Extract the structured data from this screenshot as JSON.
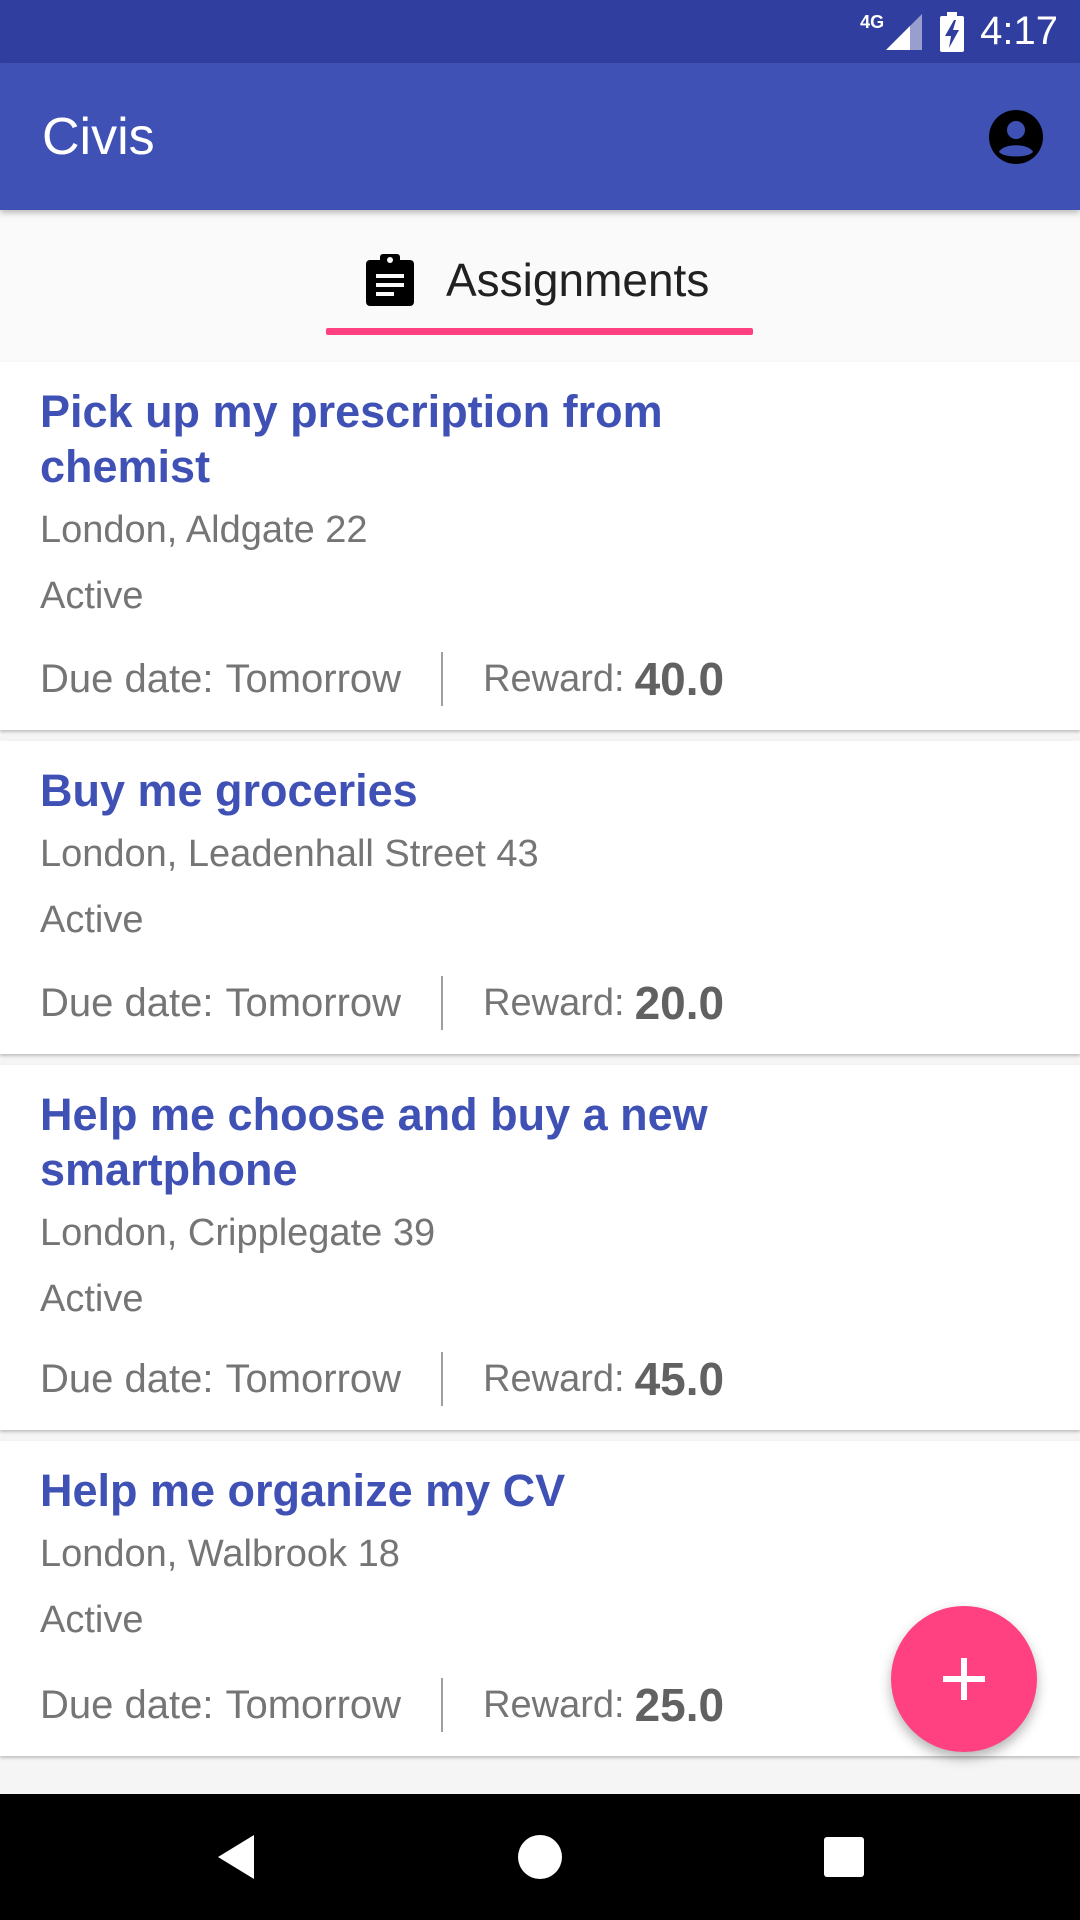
{
  "status_bar": {
    "network_type": "4G",
    "time": "4:17"
  },
  "app_bar": {
    "title": "Civis",
    "account_icon": "account-circle-icon"
  },
  "tabs": [
    {
      "label": "Assignments",
      "icon": "clipboard-icon",
      "selected": true
    }
  ],
  "labels": {
    "due_prefix": "Due date:",
    "reward_prefix": "Reward:"
  },
  "assignments": [
    {
      "title": "Pick up my prescription from chemist",
      "address": "London, Aldgate 22",
      "status": "Active",
      "due": "Tomorrow",
      "reward": "40.0"
    },
    {
      "title": "Buy me groceries",
      "address": "London, Leadenhall Street 43",
      "status": "Active",
      "due": "Tomorrow",
      "reward": "20.0"
    },
    {
      "title": "Help me choose and buy a new smartphone",
      "address": "London, Cripplegate 39",
      "status": "Active",
      "due": "Tomorrow",
      "reward": "45.0"
    },
    {
      "title": "Help me organize my CV",
      "address": "London, Walbrook 18",
      "status": "Active",
      "due": "Tomorrow",
      "reward": "25.0"
    }
  ],
  "fab": {
    "icon": "plus-icon"
  },
  "nav_bar": {
    "back_icon": "back-icon",
    "home_icon": "home-icon",
    "recents_icon": "recents-icon"
  },
  "colors": {
    "primary": "#3f51b5",
    "primary_dark": "#303f9f",
    "accent": "#ff4081"
  }
}
